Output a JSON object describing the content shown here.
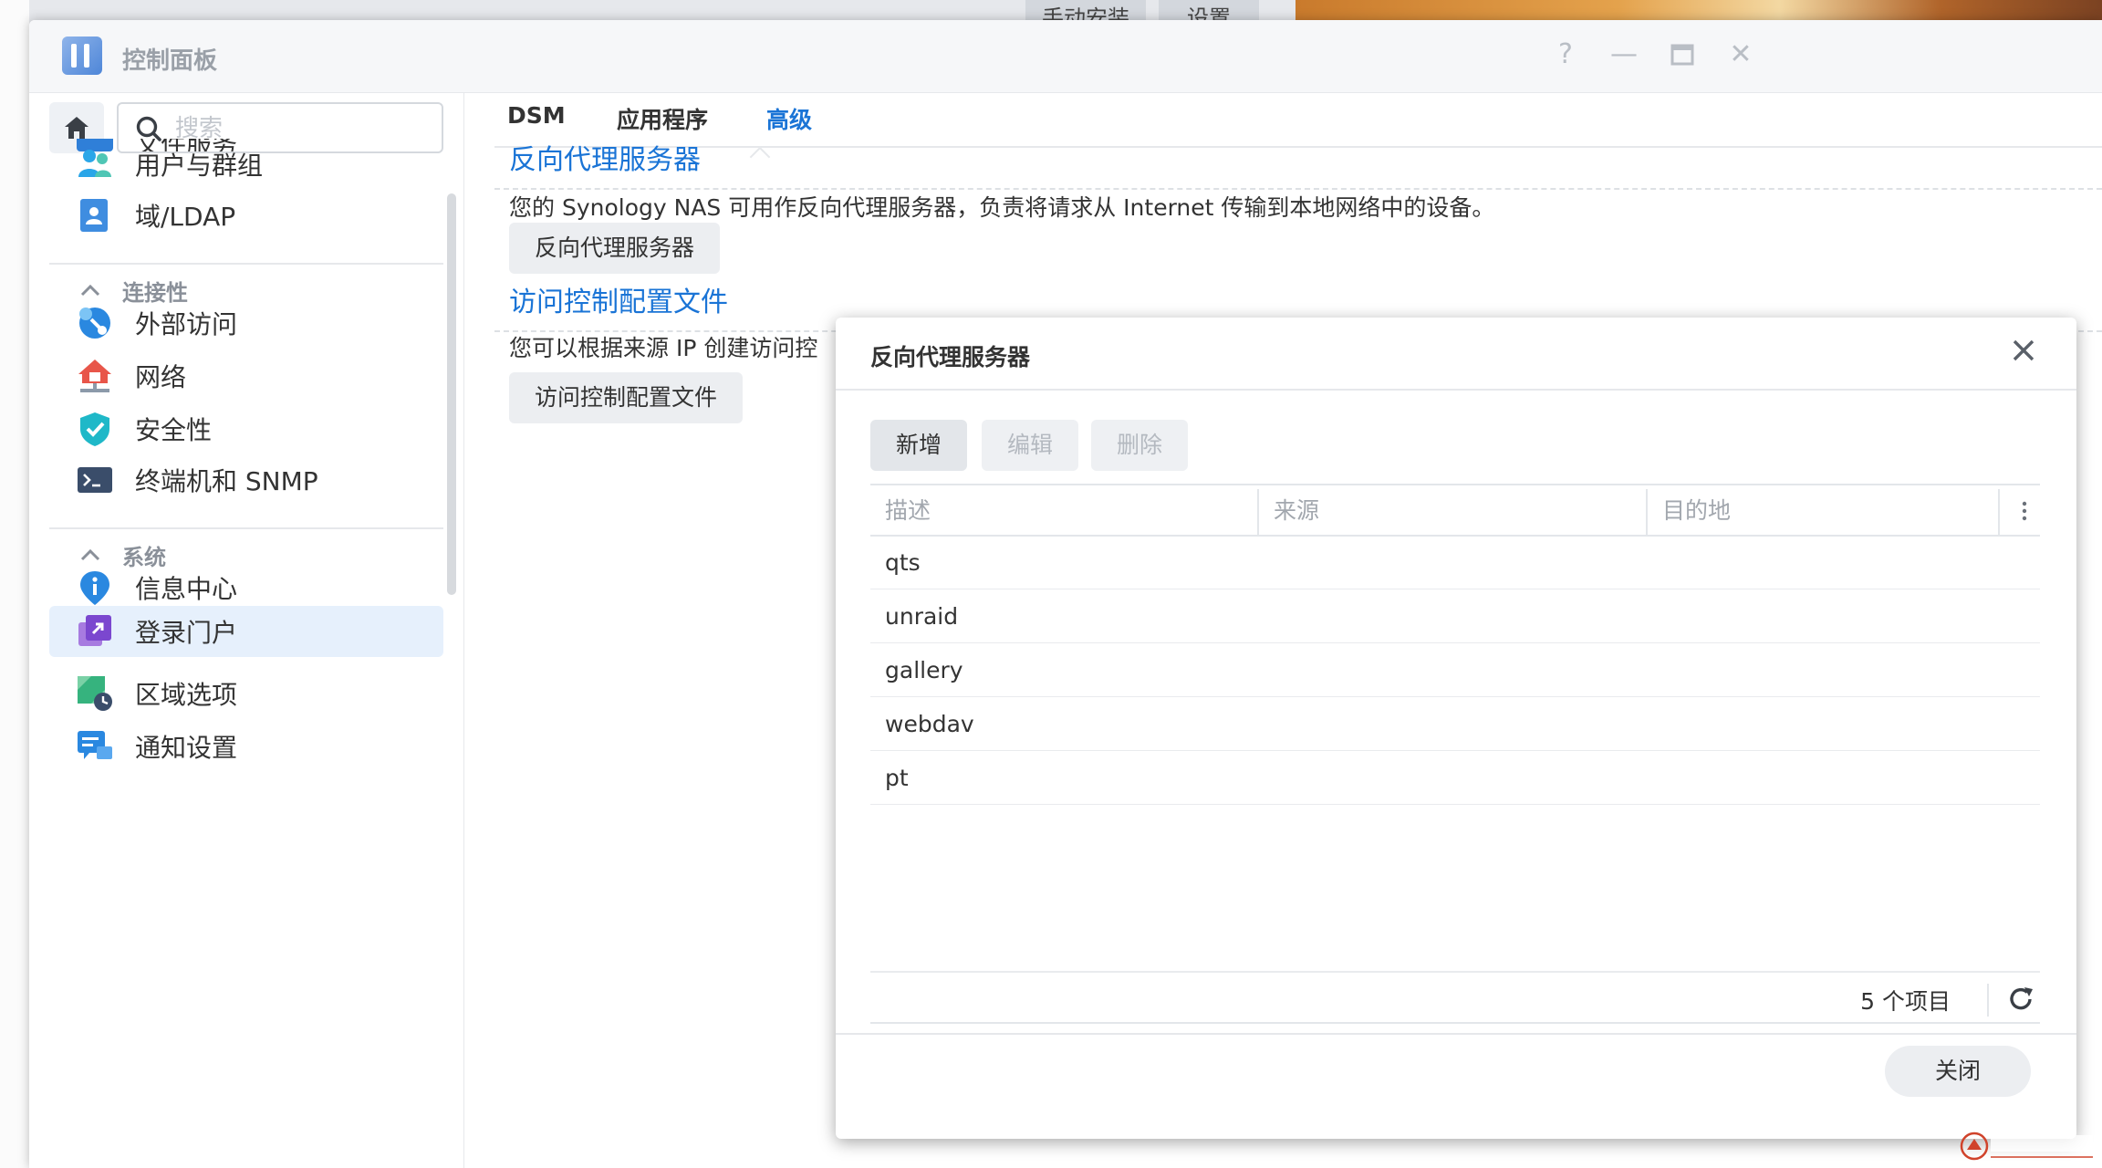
{
  "background": {
    "buttons": [
      "手动安装",
      "设置"
    ]
  },
  "window": {
    "title": "控制面板",
    "controls": {
      "help": "?",
      "minimize": "—",
      "maximize": "▭",
      "close": "✕"
    }
  },
  "sidebar": {
    "search_placeholder": "搜索",
    "partial_item": "文件服务",
    "items_top": [
      {
        "label": "用户与群组",
        "icon": "users-icon"
      },
      {
        "label": "域/LDAP",
        "icon": "domain-ldap-icon"
      }
    ],
    "section_connectivity": "连接性",
    "items_connectivity": [
      {
        "label": "外部访问",
        "icon": "external-access-icon"
      },
      {
        "label": "网络",
        "icon": "network-icon"
      },
      {
        "label": "安全性",
        "icon": "security-icon"
      },
      {
        "label": "终端机和 SNMP",
        "icon": "terminal-icon"
      }
    ],
    "section_system": "系统",
    "items_system": [
      {
        "label": "信息中心",
        "icon": "info-center-icon"
      },
      {
        "label": "登录门户",
        "icon": "login-portal-icon",
        "active": true
      },
      {
        "label": "区域选项",
        "icon": "regional-options-icon"
      },
      {
        "label": "通知设置",
        "icon": "notification-icon"
      }
    ]
  },
  "content": {
    "tabs": [
      "DSM",
      "应用程序",
      "高级"
    ],
    "active_tab": "高级",
    "section1": {
      "title": "反向代理服务器",
      "description": "您的 Synology NAS 可用作反向代理服务器，负责将请求从 Internet 传输到本地网络中的设备。",
      "button": "反向代理服务器"
    },
    "section2": {
      "title": "访问控制配置文件",
      "description": "您可以根据来源 IP 创建访问控",
      "button": "访问控制配置文件"
    }
  },
  "modal": {
    "title": "反向代理服务器",
    "toolbar": {
      "add": "新增",
      "edit": "编辑",
      "delete": "删除"
    },
    "columns": [
      "描述",
      "来源",
      "目的地"
    ],
    "rows": [
      "qts",
      "unraid",
      "gallery",
      "webdav",
      "pt"
    ],
    "item_count": "5 个项目",
    "close_label": "关闭"
  },
  "colors": {
    "accent": "#1a74d6",
    "active_bg": "#e6f0fc"
  }
}
